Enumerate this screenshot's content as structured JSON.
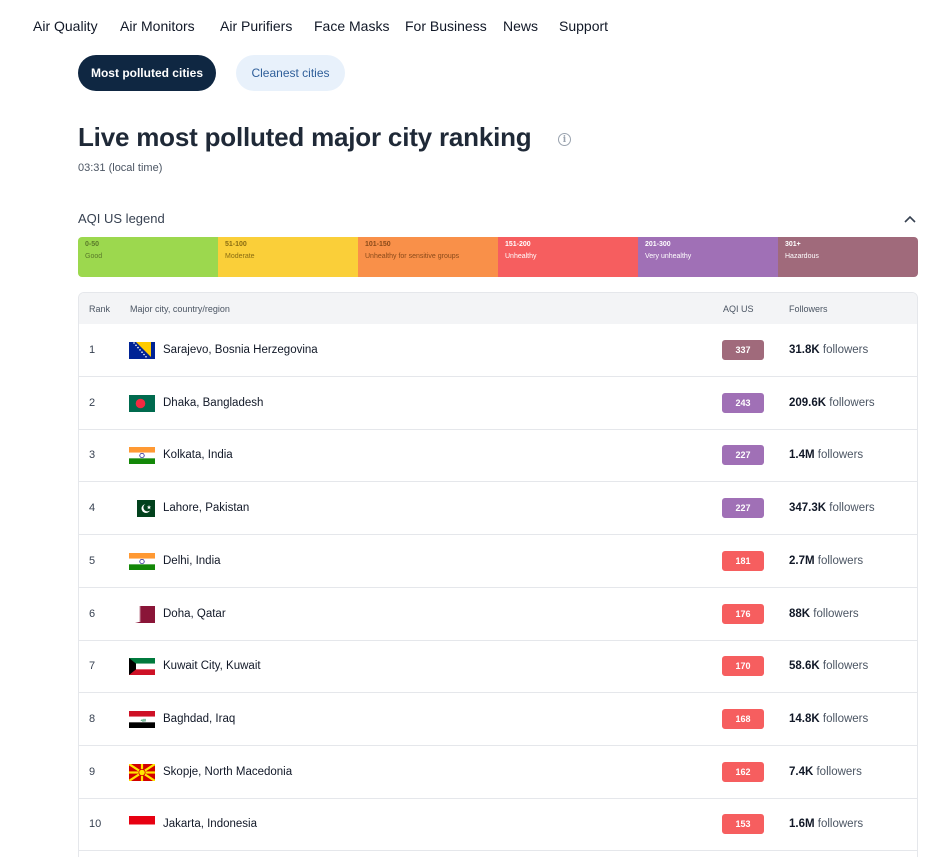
{
  "nav": {
    "items": [
      "Air Quality",
      "Air Monitors",
      "Air Purifiers",
      "Face Masks",
      "For Business",
      "News",
      "Support"
    ]
  },
  "tabs": {
    "active": "Most polluted cities",
    "inactive": "Cleanest cities"
  },
  "page": {
    "title": "Live most polluted major city ranking",
    "time": "03:31 (local time)"
  },
  "legend": {
    "title": "AQI US legend",
    "segments": [
      {
        "range": "0-50",
        "label": "Good",
        "color": "#9cd84e",
        "text_color": "#5a7a2a"
      },
      {
        "range": "51-100",
        "label": "Moderate",
        "color": "#facf39",
        "text_color": "#8a6d12"
      },
      {
        "range": "101-150",
        "label": "Unhealthy for sensitive groups",
        "color": "#f99049",
        "text_color": "#8a4a1a"
      },
      {
        "range": "151-200",
        "label": "Unhealthy",
        "color": "#f65e5f",
        "text_color": "#ffffff"
      },
      {
        "range": "201-300",
        "label": "Very unhealthy",
        "color": "#a070b6",
        "text_color": "#ffffff"
      },
      {
        "range": "301+",
        "label": "Hazardous",
        "color": "#a06a7b",
        "text_color": "#ffffff"
      }
    ]
  },
  "table": {
    "headers": {
      "rank": "Rank",
      "city": "Major city, country/region",
      "aqi": "AQI US",
      "followers": "Followers"
    },
    "rows": [
      {
        "rank": "1",
        "city": "Sarajevo, Bosnia Herzegovina",
        "flag": "bosnia-flag-icon",
        "aqi": "337",
        "aqi_color": "#a06a7b",
        "followers_value": "31.8K",
        "followers_suffix": " followers"
      },
      {
        "rank": "2",
        "city": "Dhaka, Bangladesh",
        "flag": "bangladesh-flag-icon",
        "aqi": "243",
        "aqi_color": "#a070b6",
        "followers_value": "209.6K",
        "followers_suffix": " followers"
      },
      {
        "rank": "3",
        "city": "Kolkata, India",
        "flag": "india-flag-icon",
        "aqi": "227",
        "aqi_color": "#a070b6",
        "followers_value": "1.4M",
        "followers_suffix": " followers"
      },
      {
        "rank": "4",
        "city": "Lahore, Pakistan",
        "flag": "pakistan-flag-icon",
        "aqi": "227",
        "aqi_color": "#a070b6",
        "followers_value": "347.3K",
        "followers_suffix": " followers"
      },
      {
        "rank": "5",
        "city": "Delhi, India",
        "flag": "india-flag-icon",
        "aqi": "181",
        "aqi_color": "#f65e5f",
        "followers_value": "2.7M",
        "followers_suffix": " followers"
      },
      {
        "rank": "6",
        "city": "Doha, Qatar",
        "flag": "qatar-flag-icon",
        "aqi": "176",
        "aqi_color": "#f65e5f",
        "followers_value": "88K",
        "followers_suffix": " followers"
      },
      {
        "rank": "7",
        "city": "Kuwait City, Kuwait",
        "flag": "kuwait-flag-icon",
        "aqi": "170",
        "aqi_color": "#f65e5f",
        "followers_value": "58.6K",
        "followers_suffix": " followers"
      },
      {
        "rank": "8",
        "city": "Baghdad, Iraq",
        "flag": "iraq-flag-icon",
        "aqi": "168",
        "aqi_color": "#f65e5f",
        "followers_value": "14.8K",
        "followers_suffix": " followers"
      },
      {
        "rank": "9",
        "city": "Skopje, North Macedonia",
        "flag": "north-macedonia-flag-icon",
        "aqi": "162",
        "aqi_color": "#f65e5f",
        "followers_value": "7.4K",
        "followers_suffix": " followers"
      },
      {
        "rank": "10",
        "city": "Jakarta, Indonesia",
        "flag": "indonesia-flag-icon",
        "aqi": "153",
        "aqi_color": "#f65e5f",
        "followers_value": "1.6M",
        "followers_suffix": " followers"
      }
    ]
  }
}
